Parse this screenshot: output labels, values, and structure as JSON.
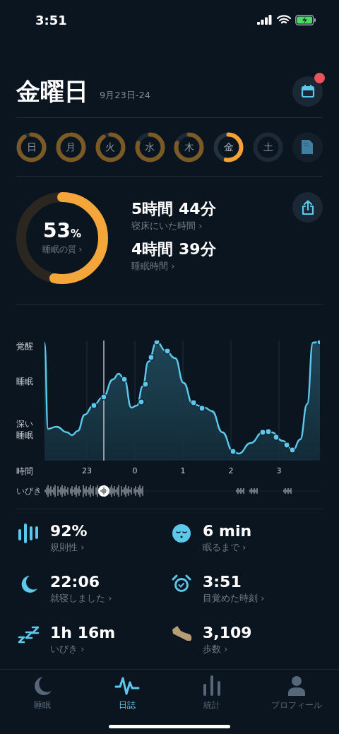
{
  "status_bar": {
    "time": "3:51"
  },
  "header": {
    "title": "金曜日",
    "date_range": "9月23日-24",
    "calendar_badge": true
  },
  "days": [
    {
      "label": "日",
      "selected": false
    },
    {
      "label": "月",
      "selected": false
    },
    {
      "label": "火",
      "selected": false
    },
    {
      "label": "水",
      "selected": false
    },
    {
      "label": "木",
      "selected": false
    },
    {
      "label": "金",
      "selected": true
    },
    {
      "label": "土",
      "selected": false
    }
  ],
  "summary": {
    "quality": {
      "value": "53",
      "unit": "%",
      "label": "睡眠の質 ›"
    },
    "metrics": [
      {
        "value": "5時間 44分",
        "label": "寝床にいた時間 ›"
      },
      {
        "value": "4時間 39分",
        "label": "睡眠時間 ›"
      }
    ]
  },
  "sleep_graph": {
    "y_labels": [
      "覚醒",
      "睡眠",
      "深い睡眠"
    ],
    "x_axis_label": "時間",
    "x_ticks": [
      "23",
      "0",
      "1",
      "2",
      "3"
    ],
    "snore_label": "いびき"
  },
  "stats": [
    {
      "kind": "regularity",
      "value": "92%",
      "label": "規則性 ›"
    },
    {
      "kind": "fall-asleep",
      "value": "6 min",
      "label": "眠るまで ›"
    },
    {
      "kind": "bedtime",
      "value": "22:06",
      "label": "就寝しました ›"
    },
    {
      "kind": "wake",
      "value": "3:51",
      "label": "目覚めた時刻 ›"
    },
    {
      "kind": "snore",
      "value": "1h 16m",
      "label": "いびき ›"
    },
    {
      "kind": "steps",
      "value": "3,109",
      "label": "歩数 ›"
    }
  ],
  "tabs": [
    {
      "kind": "sleep",
      "label": "睡眠",
      "selected": false
    },
    {
      "kind": "journal",
      "label": "日誌",
      "selected": true
    },
    {
      "kind": "stats",
      "label": "統計",
      "selected": false
    },
    {
      "kind": "profile",
      "label": "プロフィール",
      "selected": false
    }
  ]
}
